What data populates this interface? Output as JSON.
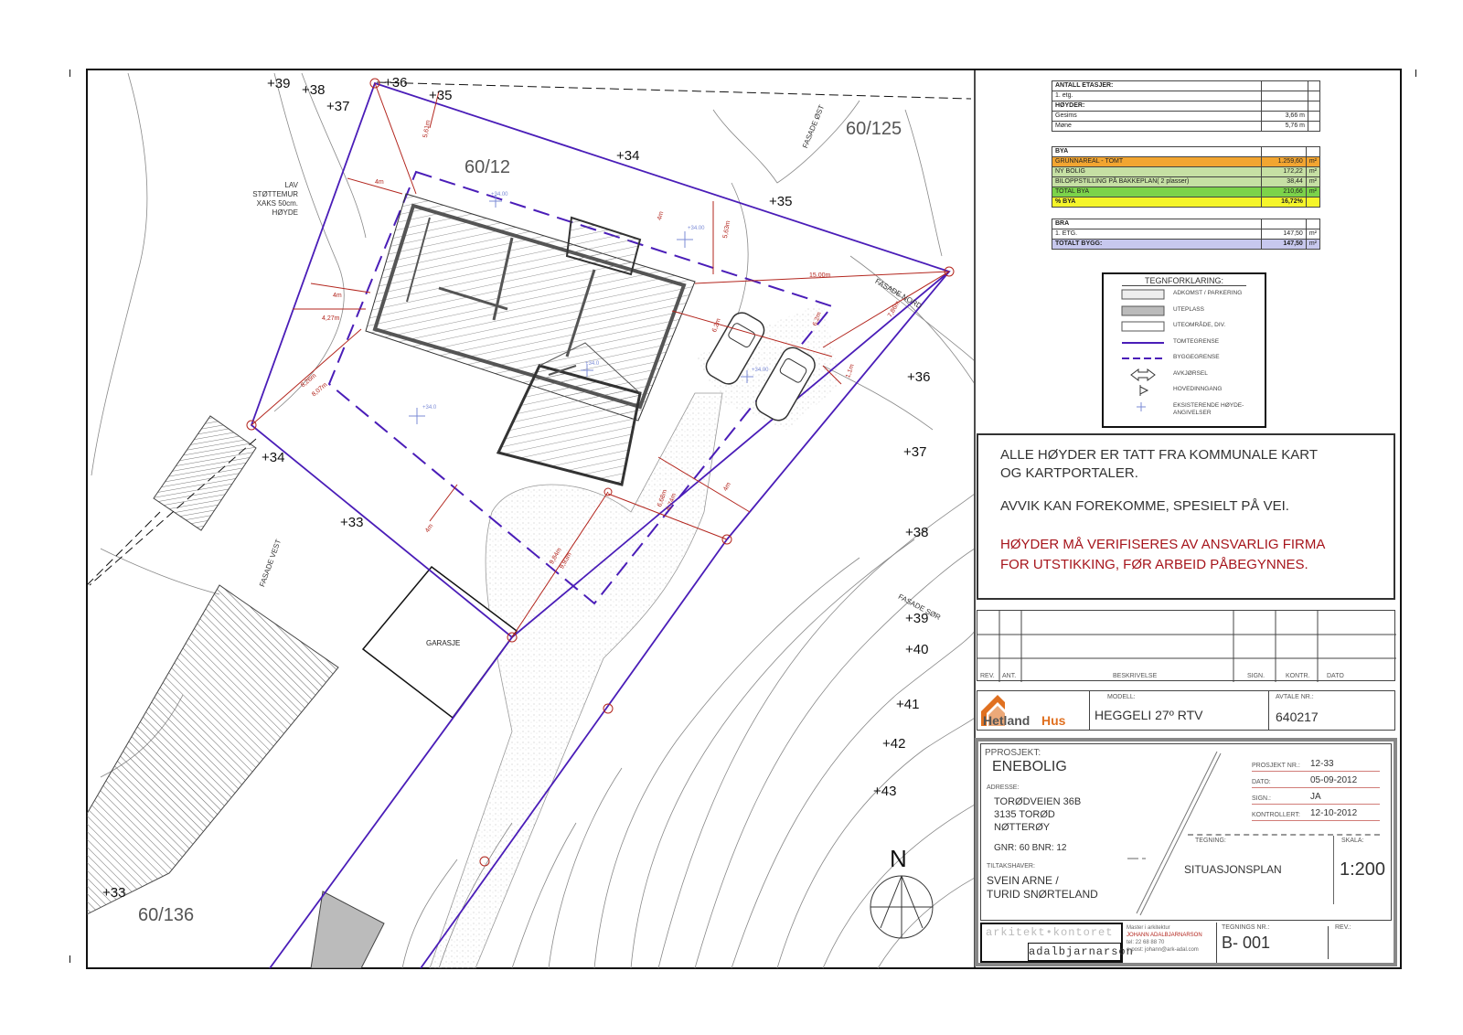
{
  "map": {
    "parcels": [
      "60/125",
      "60/12",
      "60/136"
    ],
    "elevations": [
      "+39",
      "+38",
      "+37",
      "+36",
      "+35",
      "+34",
      "+35",
      "+36",
      "+37",
      "+38",
      "+39",
      "+40",
      "+41",
      "+42",
      "+43",
      "+34",
      "+33",
      "+33"
    ],
    "facade_labels": [
      "FASADE ØST",
      "FASADE NORD",
      "FASADE VEST",
      "FASADE SØR"
    ],
    "annotations": {
      "wall_note": [
        "LAV STØTTEMUR",
        "XAKS 50cm.",
        "HØYDE"
      ],
      "garage": "GARASJE",
      "spot_heights": [
        "+34.00",
        "+34.00",
        "+34.0",
        "+34.0",
        "+34.00"
      ],
      "dims": [
        "5,61m",
        "4m",
        "15,00m",
        "7,86m",
        "6,2m",
        "6,2m",
        "4m",
        "4m",
        "4,27m",
        "8,26m",
        "8,07m",
        "6,68m",
        "6,74m",
        "9,84m",
        "9,93m",
        "4m",
        "5,63m",
        "4m",
        "4m",
        "1,1m"
      ]
    },
    "north_label": "N"
  },
  "area_table": {
    "sections": [
      {
        "rows": [
          {
            "label": "ANTALL ETASJER:",
            "value": "",
            "bold": true
          },
          {
            "label": "1. etg.",
            "value": ""
          },
          {
            "label": "HØYDER:",
            "value": "",
            "bold": true
          },
          {
            "label": "Gesims",
            "value": "3,66 m"
          },
          {
            "label": "Møne",
            "value": "5,76 m"
          }
        ]
      },
      {
        "rows": [
          {
            "label": "BYA",
            "value": "",
            "bold": true
          },
          {
            "label": "GRUNNAREAL - TOMT",
            "value": "1.259,60",
            "unit": "m²",
            "color": "#f2a531"
          },
          {
            "label": "NY BOLIG",
            "value": "172,22",
            "unit": "m²",
            "color": "#c6e0a4"
          },
          {
            "label": "BILOPPSTILLING PÅ BAKKEPLAN( 2 plasser)",
            "value": "38,44",
            "unit": "m²",
            "color": "#c6e0a4"
          },
          {
            "label": "TOTAL BYA",
            "value": "210,66",
            "unit": "m²",
            "color": "#7cd34a"
          },
          {
            "label": "% BYA",
            "value": "16,72%",
            "color": "#f5f52a",
            "bold": true
          }
        ]
      },
      {
        "rows": [
          {
            "label": "BRA",
            "value": "",
            "bold": true
          },
          {
            "label": "1. ETG.",
            "value": "147,50",
            "unit": "m²"
          },
          {
            "label": "TOTALT BYGG:",
            "value": "147,50",
            "unit": "m²",
            "color": "#c7c8ee",
            "bold": true
          }
        ]
      }
    ]
  },
  "legend": {
    "title": "TEGNFORKLARING:",
    "items": [
      "ADKOMST / PARKERING",
      "UTEPLASS",
      "UTEOMRÅDE, DIV.",
      "TOMTEGRENSE",
      "BYGGEGRENSE",
      "AVKJØRSEL",
      "HOVEDINNGANG",
      "EKSISTERENDE HØYDE-ANGIVELSER"
    ]
  },
  "notes": {
    "line1": "ALLE HØYDER ER TATT FRA KOMMUNALE KART",
    "line2": "OG KARTPORTALER.",
    "line3": "AVVIK KAN FOREKOMME, SPESIELT PÅ VEI.",
    "warn1": "HØYDER MÅ VERIFISERES AV ANSVARLIG FIRMA",
    "warn2": "FOR UTSTIKKING, FØR ARBEID PÅBEGYNNES.",
    "warn_color": "#a6141b"
  },
  "revision": {
    "headers": [
      "REV.",
      "ANT.",
      "BESKRIVELSE",
      "SIGN.",
      "KONTR.",
      "DATO"
    ]
  },
  "model": {
    "logo_text": [
      "Hetland",
      "Hus"
    ],
    "model_label": "MODELL:",
    "model_value": "HEGGELI 27º RTV",
    "avtale_label": "AVTALE NR.:",
    "avtale_value": "640217"
  },
  "project": {
    "proj_label": "PPROSJEKT:",
    "proj_value": "ENEBOLIG",
    "adr_label": "ADRESSE:",
    "adr_lines": [
      "TORØDVEIEN 36B",
      "3135 TORØD",
      "NØTTERØY"
    ],
    "gnr": "GNR: 60  BNR: 12",
    "owner_label": "TILTAKSHAVER:",
    "owner_lines": [
      "SVEIN ARNE /",
      "TURID SNØRTELAND"
    ],
    "fields": [
      {
        "label": "PROSJEKT NR.:",
        "value": "12-33"
      },
      {
        "label": "DATO:",
        "value": "05-09-2012"
      },
      {
        "label": "SIGN.:",
        "value": "JA"
      },
      {
        "label": "KONTROLLERT:",
        "value": "12-10-2012"
      }
    ],
    "tegning_label": "TEGNING:",
    "tegning_value": "SITUASJONSPLAN",
    "skala_label": "SKALA:",
    "skala_value": "1:200"
  },
  "office": {
    "logo_top": "arkitekt•kontoret",
    "logo_bottom": "adalbjarnarson",
    "role": "Master i arkitektur",
    "name": "JOHANN ADALBJARNARSON",
    "tel": "tel: 22 68 88 70",
    "email": "e-post: johann@ark-adal.com",
    "tegn_label": "TEGNINGS NR.:",
    "tegn_value": "B- 001",
    "rev_label": "REV.:"
  },
  "colors": {
    "boundary": "#4a1db8",
    "dimension": "#b3261e",
    "frame": "#111111"
  }
}
